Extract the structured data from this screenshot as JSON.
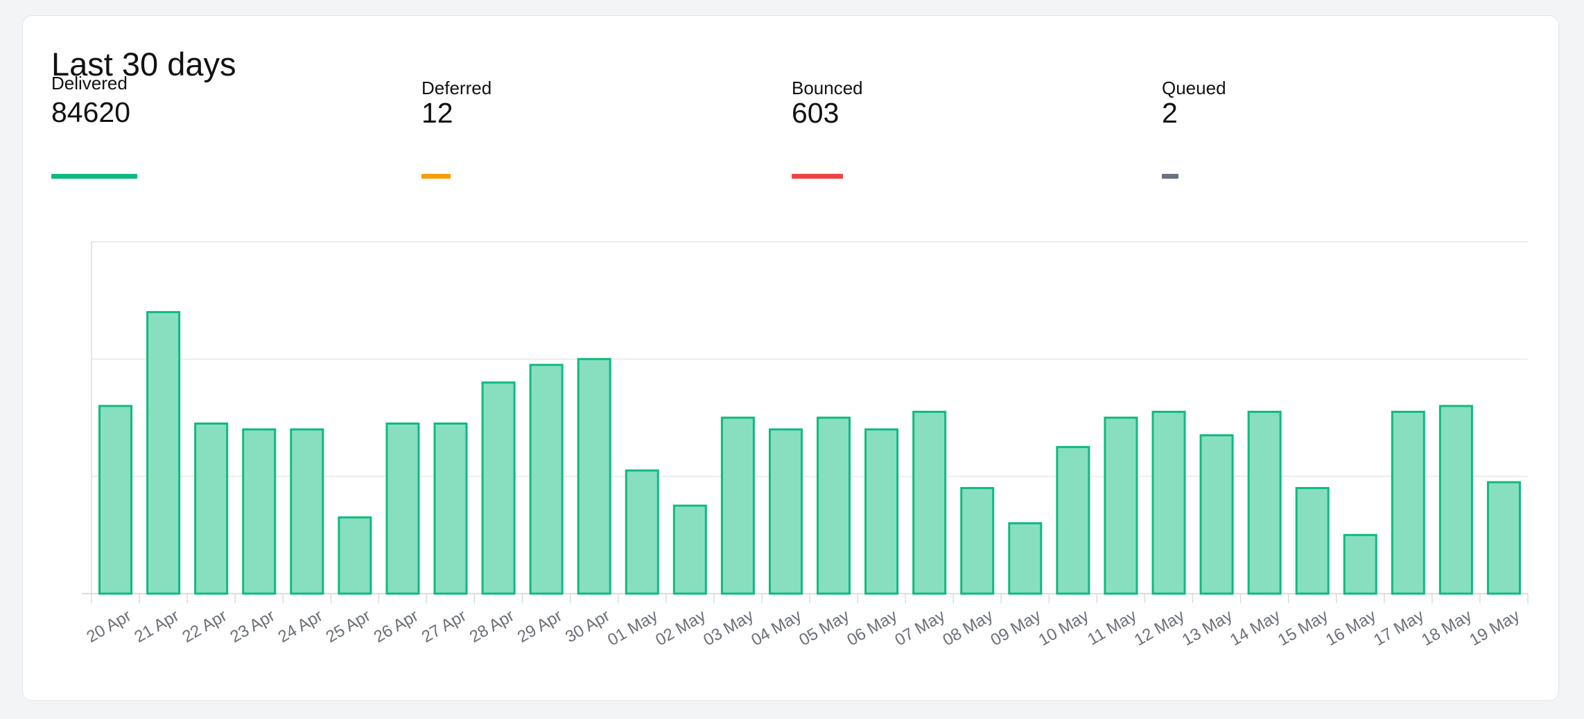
{
  "card": {
    "title": "Last 30 days"
  },
  "stats": [
    {
      "label": "Delivered",
      "value": "84620",
      "color": "#10b981"
    },
    {
      "label": "Deferred",
      "value": "12",
      "color": "#f59e0b"
    },
    {
      "label": "Bounced",
      "value": "603",
      "color": "#ef4444"
    },
    {
      "label": "Queued",
      "value": "2",
      "color": "#6b7280"
    }
  ],
  "chart_data": {
    "type": "bar",
    "categories": [
      "20 Apr",
      "21 Apr",
      "22 Apr",
      "23 Apr",
      "24 Apr",
      "25 Apr",
      "26 Apr",
      "27 Apr",
      "28 Apr",
      "29 Apr",
      "30 Apr",
      "01 May",
      "02 May",
      "03 May",
      "04 May",
      "05 May",
      "06 May",
      "07 May",
      "08 May",
      "09 May",
      "10 May",
      "11 May",
      "12 May",
      "13 May",
      "14 May",
      "15 May",
      "16 May",
      "17 May",
      "18 May",
      "19 May"
    ],
    "series": [
      {
        "values": [
          32,
          48,
          29,
          28,
          28,
          13,
          29,
          29,
          36,
          39,
          40,
          21,
          15,
          30,
          28,
          30,
          28,
          31,
          18,
          12,
          25,
          30,
          31,
          27,
          31,
          18,
          10,
          31,
          32,
          19
        ]
      }
    ],
    "ylim": [
      0,
      60
    ],
    "grid": true,
    "bar_fill": "#88dfbf",
    "bar_stroke": "#10b981"
  }
}
